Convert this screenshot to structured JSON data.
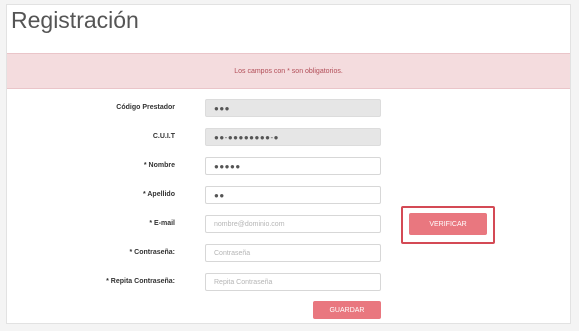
{
  "page": {
    "title": "Registración",
    "notice": "Los campos con * son obligatorios."
  },
  "form": {
    "codigo_prestador": {
      "label": "Código Prestador",
      "value": "●●●"
    },
    "cuit": {
      "label": "C.U.I.T",
      "value": "●●-●●●●●●●●-●"
    },
    "nombre": {
      "label": "* Nombre",
      "value": "●●●●●"
    },
    "apellido": {
      "label": "* Apellido",
      "value": "●●"
    },
    "email": {
      "label": "* E-mail",
      "placeholder": "nombre@dominio.com"
    },
    "contrasena": {
      "label": "* Contraseña:",
      "placeholder": "Contraseña"
    },
    "repita_contrasena": {
      "label": "* Repita Contraseña:",
      "placeholder": "Repita Contraseña"
    }
  },
  "buttons": {
    "verificar": "VERIFICAR",
    "guardar": "GUARDAR"
  },
  "colors": {
    "accent": "#e9777f",
    "alert_bg": "#f4dcde",
    "highlight": "#d44a55"
  }
}
